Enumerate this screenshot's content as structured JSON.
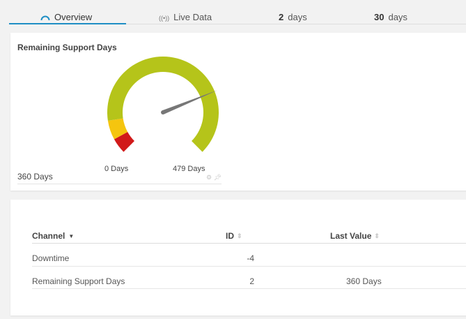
{
  "tabs": [
    {
      "label": "Overview",
      "icon": "gauge-icon",
      "active": true
    },
    {
      "label": "Live Data",
      "icon": "live-signal-icon",
      "active": false
    },
    {
      "number": "2",
      "unit": "days",
      "active": false
    },
    {
      "number": "30",
      "unit": "days",
      "active": false
    }
  ],
  "gauge": {
    "title": "Remaining Support Days",
    "value_label": "360 Days",
    "min_label": "0 Days",
    "max_label": "479 Days",
    "value": 360,
    "min": 0,
    "max": 479,
    "colors": {
      "green": "#b5c41a",
      "yellow": "#f5c50f",
      "red": "#d11a1a",
      "needle": "#777777"
    },
    "tools_icons": [
      "gear-icon",
      "pin-icon"
    ]
  },
  "table": {
    "headers": {
      "channel": "Channel",
      "id": "ID",
      "last_value": "Last Value"
    },
    "rows": [
      {
        "channel": "Downtime",
        "id": "-4",
        "last_value": ""
      },
      {
        "channel": "Remaining Support Days",
        "id": "2",
        "last_value": "360 Days"
      }
    ]
  },
  "accent_color": "#1f8ec4"
}
